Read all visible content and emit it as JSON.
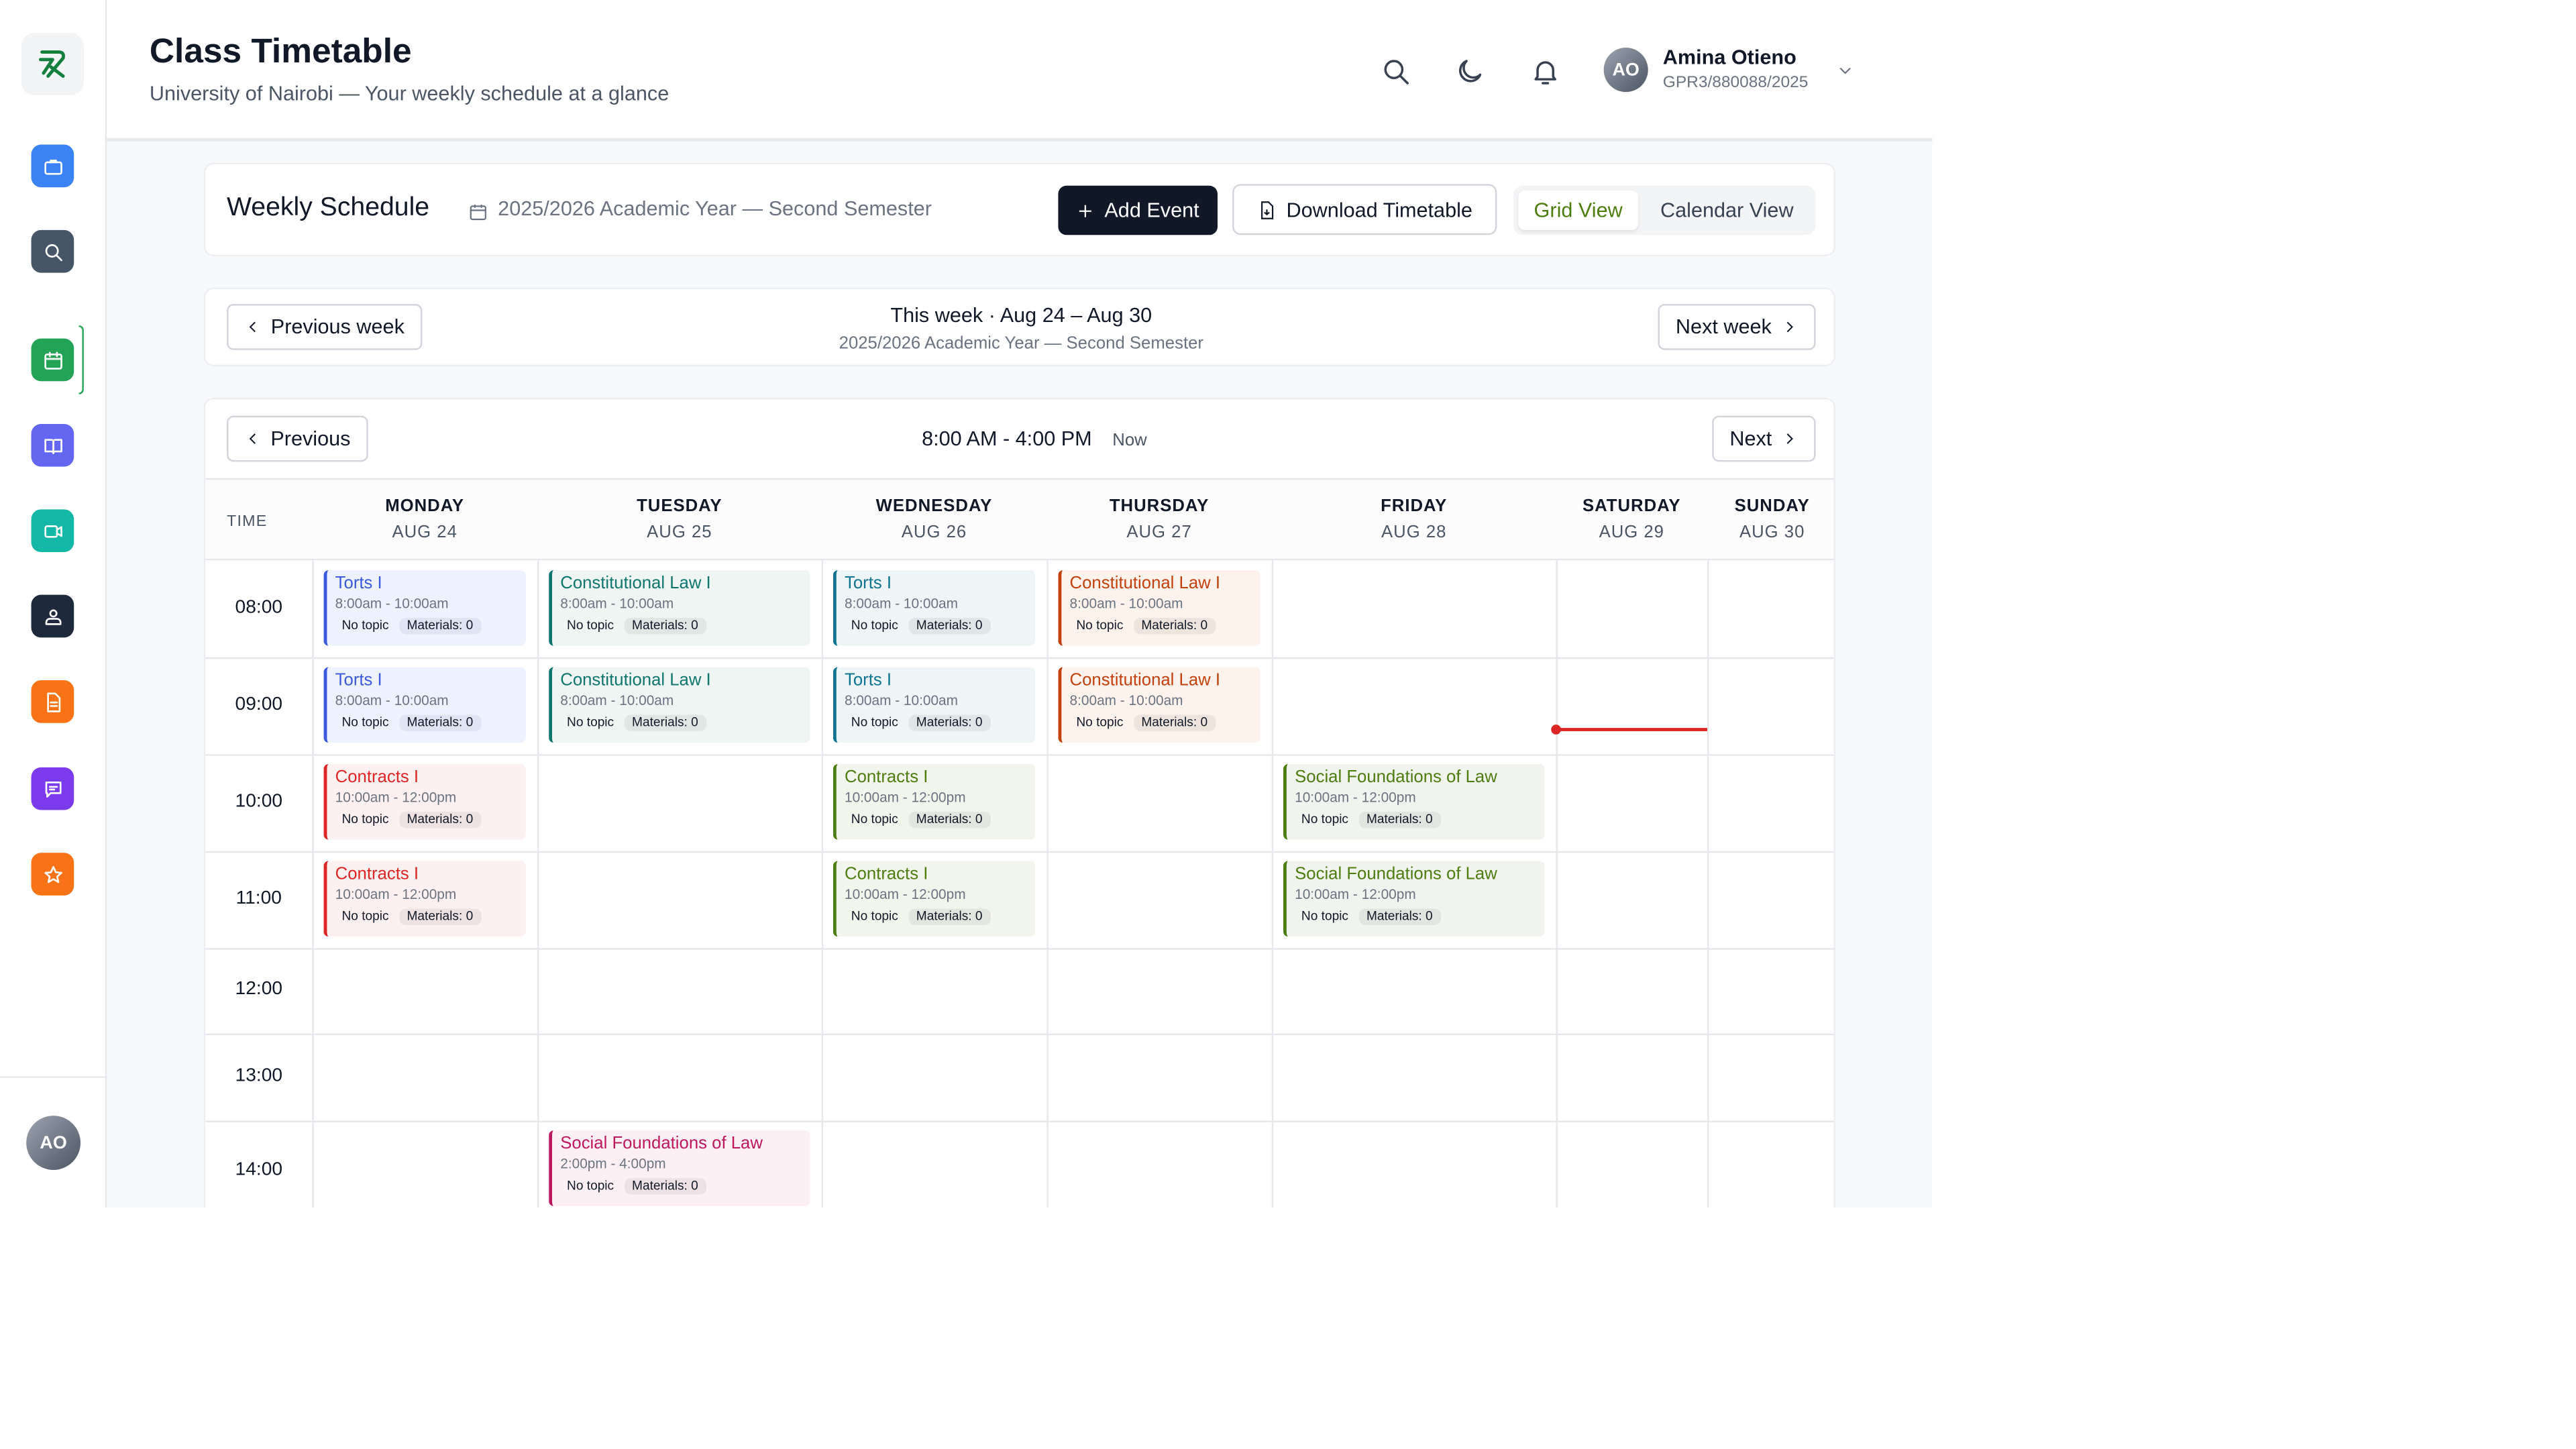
{
  "header": {
    "title": "Class Timetable",
    "subtitle": "University of Nairobi — Your weekly schedule at a glance",
    "user": {
      "initials": "AO",
      "name": "Amina Otieno",
      "id": "GPR3/880088/2025"
    }
  },
  "sidebar": {
    "items": [
      {
        "icon": "briefcase-icon",
        "color": "#3b82f6"
      },
      {
        "icon": "search-icon",
        "color": "#475569"
      },
      {
        "icon": "calendar-icon",
        "color": "#22a355",
        "active": true
      },
      {
        "icon": "book-icon",
        "color": "#6366f1"
      },
      {
        "icon": "video-icon",
        "color": "#14b8a6"
      },
      {
        "icon": "user-group-icon",
        "color": "#1e293b"
      },
      {
        "icon": "document-icon",
        "color": "#f97316"
      },
      {
        "icon": "chat-icon",
        "color": "#7c3aed"
      },
      {
        "icon": "star-icon",
        "color": "#f97316"
      }
    ],
    "avatar_initials": "AO"
  },
  "schedule": {
    "title": "Weekly Schedule",
    "term": "2025/2026 Academic Year — Second Semester",
    "add_event": "Add Event",
    "download": "Download Timetable",
    "grid_view": "Grid View",
    "calendar_view": "Calendar View"
  },
  "week_nav": {
    "prev": "Previous week",
    "next": "Next week",
    "range": "This week · Aug 24 – Aug 30",
    "term": "2025/2026 Academic Year — Second Semester"
  },
  "timetable": {
    "prev": "Previous",
    "next": "Next",
    "range": "8:00 AM - 4:00 PM",
    "now": "Now",
    "time_header": "TIME",
    "days": [
      {
        "name": "MONDAY",
        "date": "AUG 24"
      },
      {
        "name": "TUESDAY",
        "date": "AUG 25"
      },
      {
        "name": "WEDNESDAY",
        "date": "AUG 26"
      },
      {
        "name": "THURSDAY",
        "date": "AUG 27"
      },
      {
        "name": "FRIDAY",
        "date": "AUG 28"
      },
      {
        "name": "SATURDAY",
        "date": "AUG 29"
      },
      {
        "name": "SUNDAY",
        "date": "AUG 30"
      }
    ],
    "hours": [
      "08:00",
      "09:00",
      "10:00",
      "11:00",
      "12:00",
      "13:00",
      "14:00"
    ],
    "events": [
      {
        "day": 0,
        "hour": 0,
        "title": "Torts I",
        "time": "8:00am - 10:00am",
        "topic": "No topic",
        "materials": "Materials: 0",
        "color": "#3b5bdb",
        "bg": "#eef2ff"
      },
      {
        "day": 0,
        "hour": 1,
        "title": "Torts I",
        "time": "8:00am - 10:00am",
        "topic": "No topic",
        "materials": "Materials: 0",
        "color": "#3b5bdb",
        "bg": "#eef2ff"
      },
      {
        "day": 0,
        "hour": 2,
        "title": "Contracts I",
        "time": "10:00am - 12:00pm",
        "topic": "No topic",
        "materials": "Materials: 0",
        "color": "#dc2626",
        "bg": "#fdf0f0"
      },
      {
        "day": 0,
        "hour": 3,
        "title": "Contracts I",
        "time": "10:00am - 12:00pm",
        "topic": "No topic",
        "materials": "Materials: 0",
        "color": "#dc2626",
        "bg": "#fdf0f0"
      },
      {
        "day": 1,
        "hour": 0,
        "title": "Constitutional Law I",
        "time": "8:00am - 10:00am",
        "topic": "No topic",
        "materials": "Materials: 0",
        "color": "#0f766e",
        "bg": "#eef5f3"
      },
      {
        "day": 1,
        "hour": 1,
        "title": "Constitutional Law I",
        "time": "8:00am - 10:00am",
        "topic": "No topic",
        "materials": "Materials: 0",
        "color": "#0f766e",
        "bg": "#eef5f3"
      },
      {
        "day": 1,
        "hour": 6,
        "title": "Social Foundations of Law",
        "time": "2:00pm - 4:00pm",
        "topic": "No topic",
        "materials": "Materials: 0",
        "color": "#be185d",
        "bg": "#fdf0f4"
      },
      {
        "day": 2,
        "hour": 0,
        "title": "Torts I",
        "time": "8:00am - 10:00am",
        "topic": "No topic",
        "materials": "Materials: 0",
        "color": "#0e7490",
        "bg": "#eef5f7"
      },
      {
        "day": 2,
        "hour": 1,
        "title": "Torts I",
        "time": "8:00am - 10:00am",
        "topic": "No topic",
        "materials": "Materials: 0",
        "color": "#0e7490",
        "bg": "#eef5f7"
      },
      {
        "day": 2,
        "hour": 2,
        "title": "Contracts I",
        "time": "10:00am - 12:00pm",
        "topic": "No topic",
        "materials": "Materials: 0",
        "color": "#4d7c0f",
        "bg": "#f2f5ec"
      },
      {
        "day": 2,
        "hour": 3,
        "title": "Contracts I",
        "time": "10:00am - 12:00pm",
        "topic": "No topic",
        "materials": "Materials: 0",
        "color": "#4d7c0f",
        "bg": "#f2f5ec"
      },
      {
        "day": 3,
        "hour": 0,
        "title": "Constitutional Law I",
        "time": "8:00am - 10:00am",
        "topic": "No topic",
        "materials": "Materials: 0",
        "color": "#c2410c",
        "bg": "#fdf3ec"
      },
      {
        "day": 3,
        "hour": 1,
        "title": "Constitutional Law I",
        "time": "8:00am - 10:00am",
        "topic": "No topic",
        "materials": "Materials: 0",
        "color": "#c2410c",
        "bg": "#fdf3ec"
      },
      {
        "day": 4,
        "hour": 2,
        "title": "Social Foundations of Law",
        "time": "10:00am - 12:00pm",
        "topic": "No topic",
        "materials": "Materials: 0",
        "color": "#4d7c0f",
        "bg": "#f1f3ee"
      },
      {
        "day": 4,
        "hour": 3,
        "title": "Social Foundations of Law",
        "time": "10:00am - 12:00pm",
        "topic": "No topic",
        "materials": "Materials: 0",
        "color": "#4d7c0f",
        "bg": "#f1f3ee"
      }
    ]
  }
}
